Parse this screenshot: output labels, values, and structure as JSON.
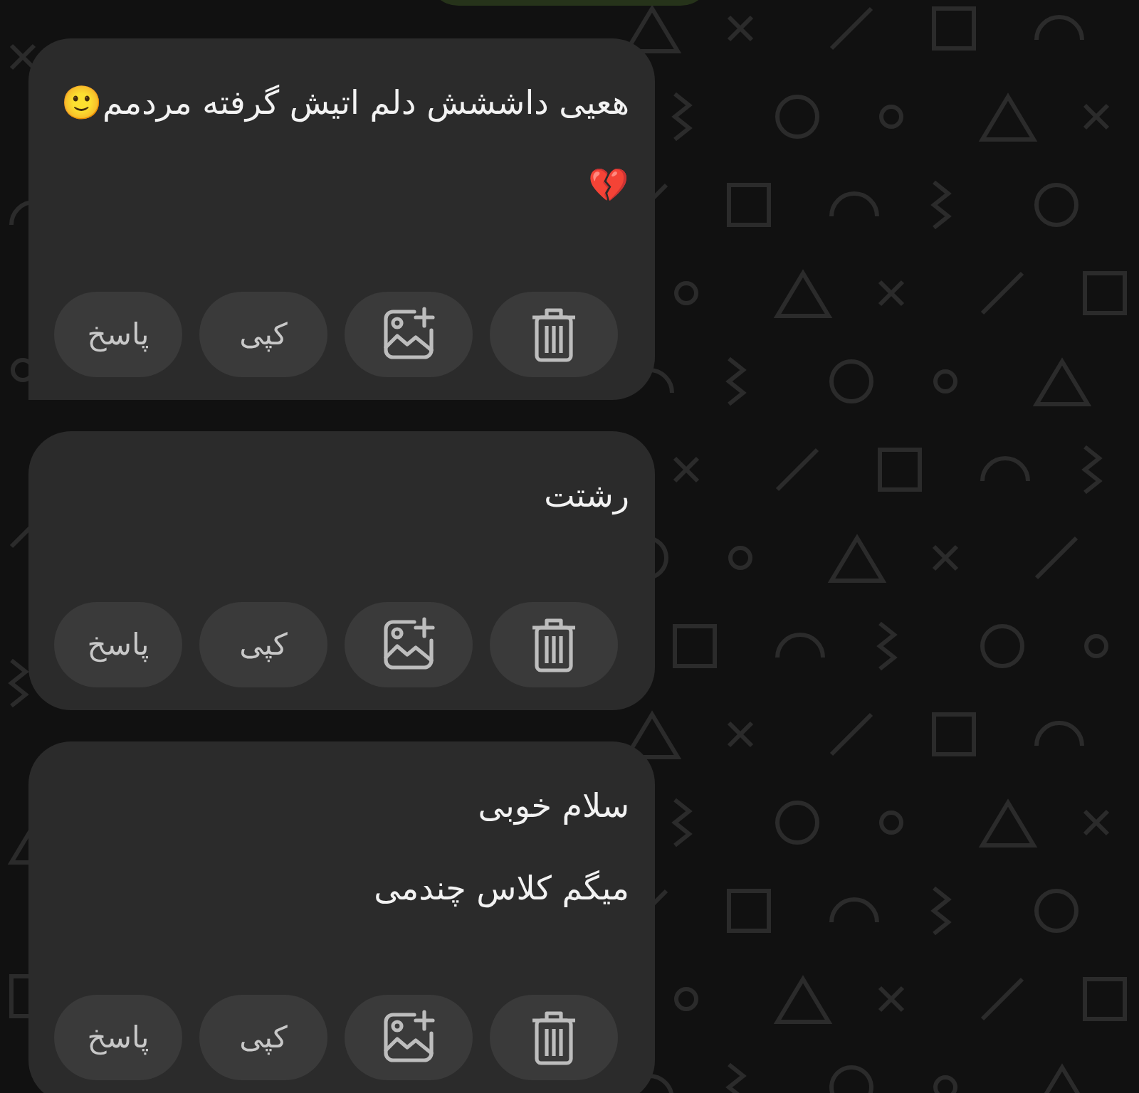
{
  "messages": [
    {
      "lines": [
        "هعیی داششش دلم اتیش گرفته مردمم🙂",
        "💔"
      ],
      "actions": [
        {
          "kind": "delete"
        },
        {
          "kind": "image"
        },
        {
          "kind": "copy",
          "label": "کپی"
        },
        {
          "kind": "reply",
          "label": "پاسخ"
        }
      ]
    },
    {
      "lines": [
        "رشتت"
      ],
      "actions": [
        {
          "kind": "delete"
        },
        {
          "kind": "image"
        },
        {
          "kind": "copy",
          "label": "کپی"
        },
        {
          "kind": "reply",
          "label": "پاسخ"
        }
      ]
    },
    {
      "lines": [
        "سلام خوبی",
        "میگم کلاس چندمی"
      ],
      "actions": [
        {
          "kind": "delete"
        },
        {
          "kind": "image"
        },
        {
          "kind": "copy",
          "label": "کپی"
        },
        {
          "kind": "reply",
          "label": "پاسخ"
        }
      ]
    }
  ]
}
